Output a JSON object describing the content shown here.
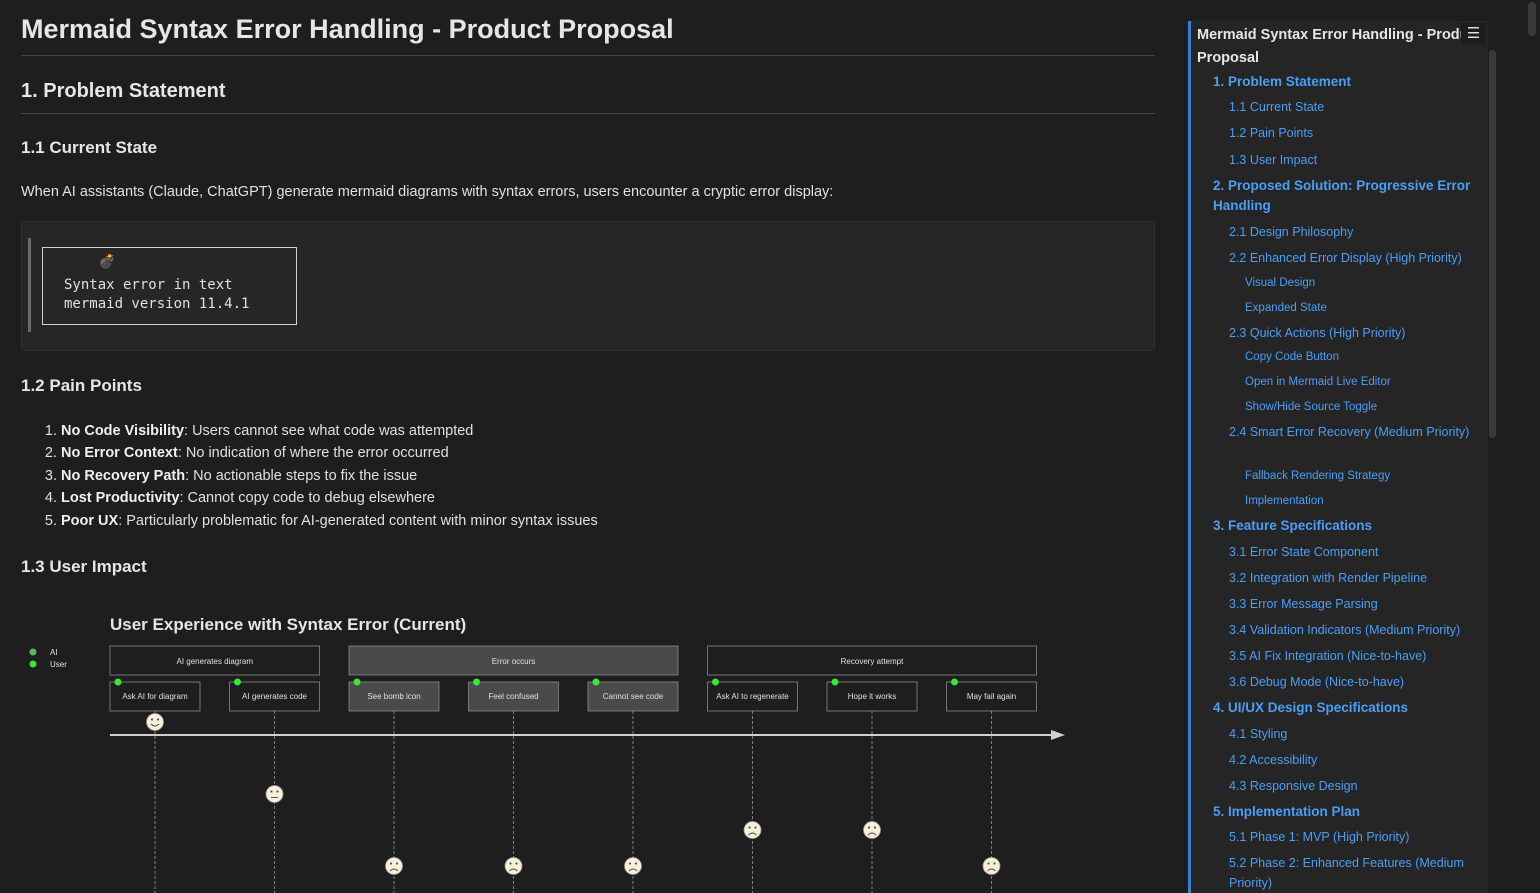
{
  "doc": {
    "title": "Mermaid Syntax Error Handling - Product Proposal",
    "sec1_heading": "1. Problem Statement",
    "sub_current_state": "1.1 Current State",
    "current_state_text": "When AI assistants (Claude, ChatGPT) generate mermaid diagrams with syntax errors, users encounter a cryptic error display:",
    "error_display": {
      "bomb": "💣",
      "line1": "Syntax error in text",
      "line2": "mermaid version 11.4.1"
    },
    "sub_pain_points": "1.2 Pain Points",
    "pain_points": [
      {
        "bold": "No Code Visibility",
        "text": ": Users cannot see what code was attempted"
      },
      {
        "bold": "No Error Context",
        "text": ": No indication of where the error occurred"
      },
      {
        "bold": "No Recovery Path",
        "text": ": No actionable steps to fix the issue"
      },
      {
        "bold": "Lost Productivity",
        "text": ": Cannot copy code to debug elsewhere"
      },
      {
        "bold": "Poor UX",
        "text": ": Particularly problematic for AI-generated content with minor syntax issues"
      }
    ],
    "sub_user_impact": "1.3 User Impact"
  },
  "journey": {
    "title": "User Experience with Syntax Error (Current)",
    "legend": [
      {
        "label": "AI",
        "color": "#5cb85c"
      },
      {
        "label": "User",
        "color": "#39e639"
      }
    ],
    "sections": [
      {
        "label": "AI generates diagram",
        "fill": "#1e1e1e"
      },
      {
        "label": "Error occurs",
        "fill": "#4a4a4a"
      },
      {
        "label": "Recovery attempt",
        "fill": "#1e1e1e"
      }
    ],
    "tasks": [
      {
        "label": "Ask AI for diagram",
        "section": 0,
        "score": 5,
        "face": "happy"
      },
      {
        "label": "AI generates code",
        "section": 0,
        "score": 3,
        "face": "neutral"
      },
      {
        "label": "See bomb icon",
        "section": 1,
        "score": 1,
        "face": "sad"
      },
      {
        "label": "Feel confused",
        "section": 1,
        "score": 1,
        "face": "sad"
      },
      {
        "label": "Cannot see code",
        "section": 1,
        "score": 1,
        "face": "sad"
      },
      {
        "label": "Ask AI to regenerate",
        "section": 2,
        "score": 2,
        "face": "sad"
      },
      {
        "label": "Hope it works",
        "section": 2,
        "score": 2,
        "face": "sad"
      },
      {
        "label": "May fail again",
        "section": 2,
        "score": 1,
        "face": "sad"
      }
    ]
  },
  "toc": {
    "title": "Mermaid Syntax Error Handling - Product Proposal",
    "menu_icon": "☰",
    "items": [
      {
        "level": 1,
        "label": "1. Problem Statement"
      },
      {
        "level": 2,
        "label": "1.1 Current State"
      },
      {
        "level": 2,
        "label": "1.2 Pain Points"
      },
      {
        "level": 2,
        "label": "1.3 User Impact"
      },
      {
        "level": 1,
        "label": "2. Proposed Solution: Progressive Error Handling"
      },
      {
        "level": 2,
        "label": "2.1 Design Philosophy"
      },
      {
        "level": 2,
        "label": "2.2 Enhanced Error Display (High Priority)"
      },
      {
        "level": 3,
        "label": "Visual Design"
      },
      {
        "level": 3,
        "label": "Expanded State"
      },
      {
        "level": 2,
        "label": "2.3 Quick Actions (High Priority)"
      },
      {
        "level": 3,
        "label": "Copy Code Button"
      },
      {
        "level": 3,
        "label": "Open in Mermaid Live Editor"
      },
      {
        "level": 3,
        "label": "Show/Hide Source Toggle"
      },
      {
        "level": 2,
        "label": "2.4 Smart Error Recovery (Medium Priority)"
      },
      {
        "level": 3,
        "label": "Fallback Rendering Strategy"
      },
      {
        "level": 3,
        "label": "Implementation"
      },
      {
        "level": 1,
        "label": "3. Feature Specifications"
      },
      {
        "level": 2,
        "label": "3.1 Error State Component"
      },
      {
        "level": 2,
        "label": "3.2 Integration with Render Pipeline"
      },
      {
        "level": 2,
        "label": "3.3 Error Message Parsing"
      },
      {
        "level": 2,
        "label": "3.4 Validation Indicators (Medium Priority)"
      },
      {
        "level": 2,
        "label": "3.5 AI Fix Integration (Nice-to-have)"
      },
      {
        "level": 2,
        "label": "3.6 Debug Mode (Nice-to-have)"
      },
      {
        "level": 1,
        "label": "4. UI/UX Design Specifications"
      },
      {
        "level": 2,
        "label": "4.1 Styling"
      },
      {
        "level": 2,
        "label": "4.2 Accessibility"
      },
      {
        "level": 2,
        "label": "4.3 Responsive Design"
      },
      {
        "level": 1,
        "label": "5. Implementation Plan"
      },
      {
        "level": 2,
        "label": "5.1 Phase 1: MVP (High Priority)"
      },
      {
        "level": 2,
        "label": "5.2 Phase 2: Enhanced Features (Medium Priority)"
      }
    ]
  }
}
